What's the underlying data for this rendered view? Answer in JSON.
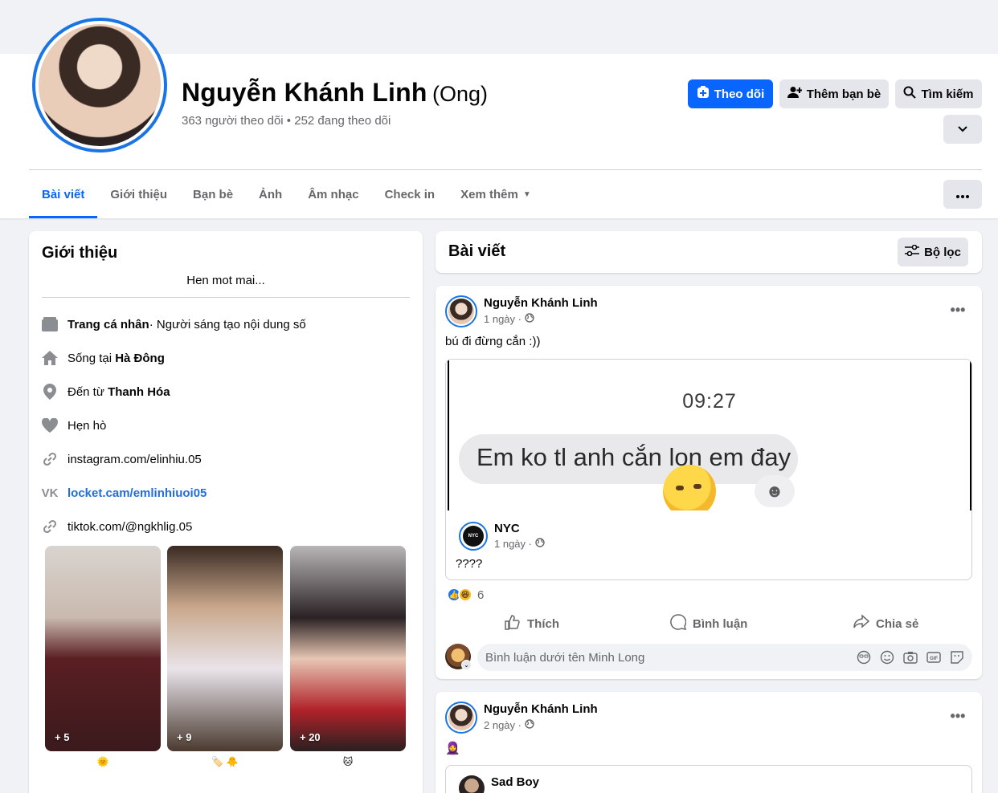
{
  "profile": {
    "name": "Nguyễn Khánh Linh",
    "nickname": "(Ong)",
    "stats": "363 người theo dõi • 252 đang theo dõi"
  },
  "actions": {
    "follow": "Theo dõi",
    "add_friend": "Thêm bạn bè",
    "search": "Tìm kiếm"
  },
  "tabs": [
    "Bài viết",
    "Giới thiệu",
    "Bạn bè",
    "Ảnh",
    "Âm nhạc",
    "Check in",
    "Xem thêm"
  ],
  "intro": {
    "title": "Giới thiệu",
    "bio": "Hen mot mai...",
    "page_label": "Trang cá nhân",
    "page_category": " · Người sáng tạo nội dung số",
    "lives_prefix": "Sống tại ",
    "lives_place": "Hà Đông",
    "from_prefix": "Đến từ ",
    "from_place": "Thanh Hóa",
    "dating": "Hẹn hò",
    "links": [
      "instagram.com/elinhiu.05",
      "locket.cam/emlinhiuoi05",
      "tiktok.com/@ngkhlig.05"
    ],
    "stories": [
      {
        "count": "+ 5",
        "emoji": "🌞"
      },
      {
        "count": "+ 9",
        "emoji": "🏷️ 🐥"
      },
      {
        "count": "+ 20",
        "emoji": "🐱"
      }
    ]
  },
  "posts_header": {
    "title": "Bài viết",
    "filter": "Bộ lọc"
  },
  "post1": {
    "author": "Nguyễn Khánh Linh",
    "time": "1 ngày ·",
    "text": "bú đi đừng cắn :))",
    "screenshot_time": "09:27",
    "screenshot_text": "Em ko tl anh cắn lon em đay",
    "shared_author": "NYC",
    "shared_avatar_text": "NYC",
    "shared_time": "1 ngày ·",
    "shared_text": "????",
    "reaction_count": "6",
    "like": "Thích",
    "comment": "Bình luận",
    "share": "Chia sẻ",
    "comment_placeholder": "Bình luận dưới tên Minh Long"
  },
  "post2": {
    "author": "Nguyễn Khánh Linh",
    "time": "2 ngày ·",
    "emoji": "🧕",
    "shared_author": "Sad Boy"
  },
  "colors": {
    "accent": "#0866ff",
    "link": "#216fdb",
    "muted": "#65676b",
    "background": "#f0f2f5"
  },
  "icons": [
    "follow-plus-icon",
    "add-friend-icon",
    "search-icon",
    "chevron-down-icon",
    "more-dots-icon",
    "filter-icon",
    "page-icon",
    "home-icon",
    "location-icon",
    "heart-icon",
    "link-icon",
    "vk-icon",
    "globe-icon",
    "like-icon",
    "comment-icon",
    "share-icon",
    "emoji-icon",
    "camera-icon",
    "gif-icon",
    "sticker-icon",
    "avatar-icon"
  ]
}
